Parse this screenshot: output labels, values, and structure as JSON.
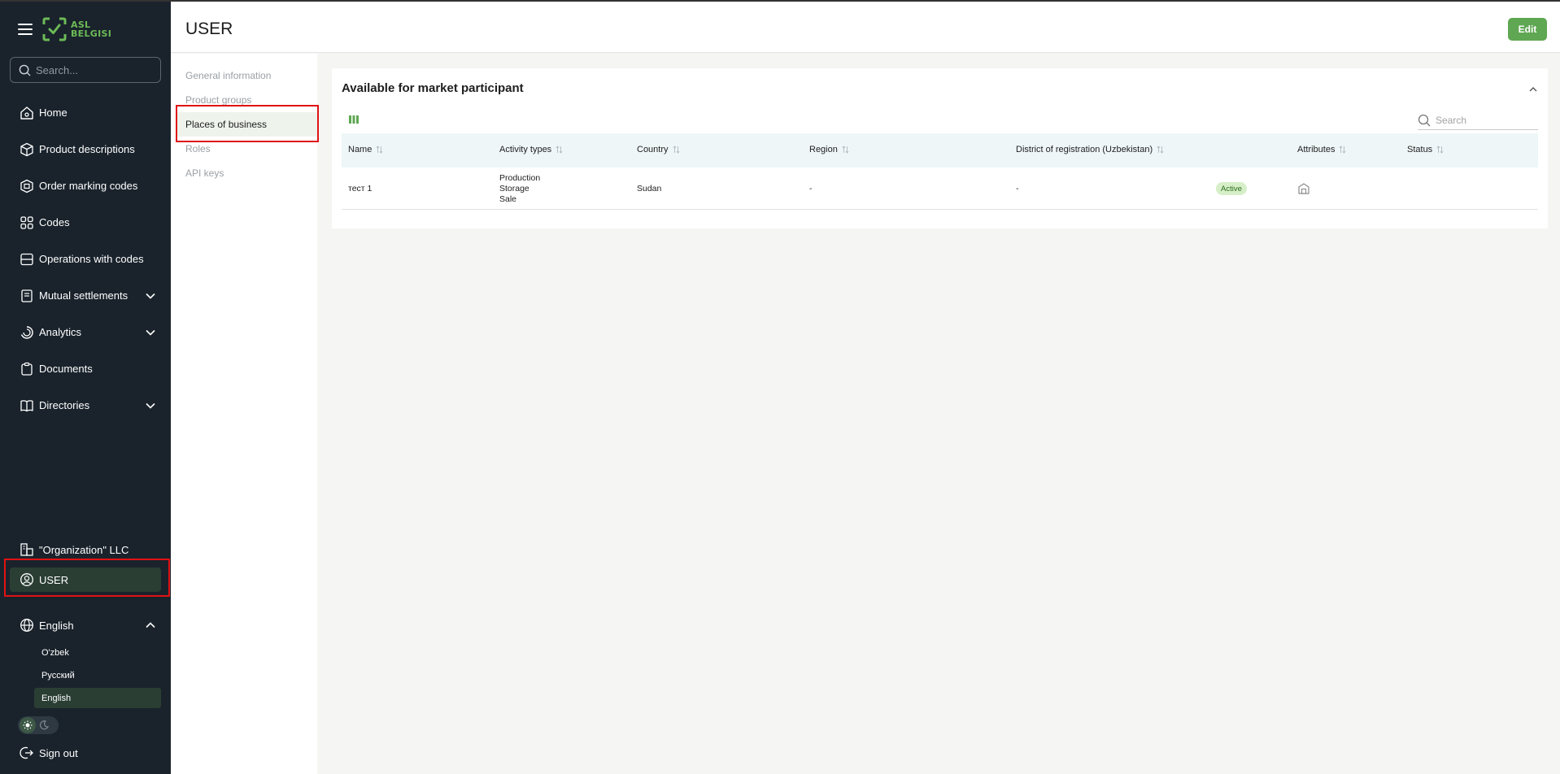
{
  "brand": {
    "line1": "ASL",
    "line2": "BELGISI"
  },
  "search": {
    "placeholder": "Search..."
  },
  "nav": [
    {
      "label": "Home"
    },
    {
      "label": "Product descriptions"
    },
    {
      "label": "Order marking codes"
    },
    {
      "label": "Codes"
    },
    {
      "label": "Operations with codes"
    },
    {
      "label": "Mutual settlements"
    },
    {
      "label": "Analytics"
    },
    {
      "label": "Documents"
    },
    {
      "label": "Directories"
    }
  ],
  "org": {
    "label": "\"Organization\" LLC"
  },
  "user": {
    "label": "USER"
  },
  "language": {
    "current": "English",
    "options": [
      "O'zbek",
      "Русский",
      "English"
    ]
  },
  "signout": {
    "label": "Sign out"
  },
  "header": {
    "title": "USER",
    "edit_label": "Edit"
  },
  "subnav": {
    "items": [
      "General information",
      "Product groups",
      "Places of business",
      "Roles",
      "API keys"
    ],
    "active": "Places of business"
  },
  "card": {
    "title": "Available for market participant",
    "search_placeholder": "Search",
    "columns": [
      "Name",
      "Activity types",
      "Country",
      "Region",
      "District of registration (Uzbekistan)",
      "Attributes",
      "Status"
    ],
    "rows": [
      {
        "name": "тест 1",
        "activity_types": [
          "Production",
          "Storage",
          "Sale"
        ],
        "country": "Sudan",
        "region": "-",
        "district": "-",
        "attributes_icon": "warehouse-icon",
        "status": "Active"
      }
    ]
  },
  "colors": {
    "sidebar_bg": "#1a232c",
    "accent_green": "#5fa753",
    "highlight_red": "#e01212"
  }
}
